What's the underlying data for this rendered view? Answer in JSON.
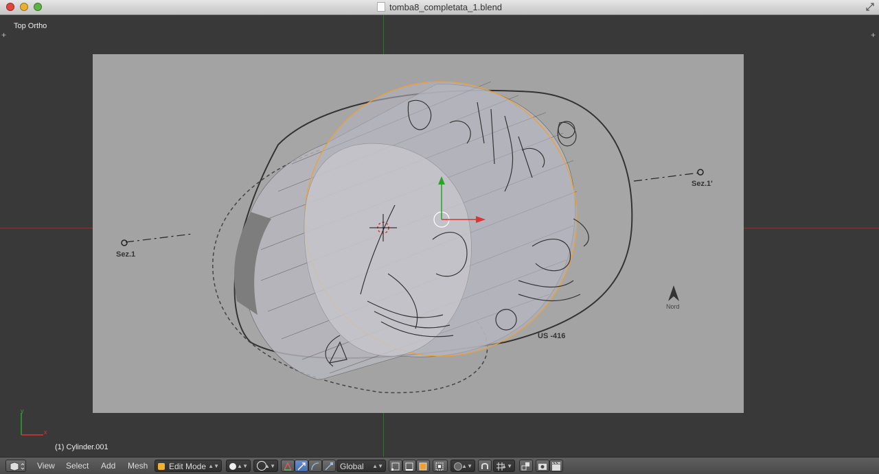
{
  "window": {
    "title": "tomba8_completata_1.blend"
  },
  "viewport": {
    "view_name": "Top Ortho",
    "active_object": "(1) Cylinder.001",
    "scene_labels": {
      "section_left": "Sez.1",
      "section_right": "Sez.1'",
      "us_label": "US -416",
      "north": "Nord"
    }
  },
  "toolbar": {
    "menus": [
      "View",
      "Select",
      "Add",
      "Mesh"
    ],
    "mode": "Edit Mode",
    "orientation": "Global"
  },
  "icons": {
    "editor_type": "cube-editor-icon",
    "shading": "solid-sphere-icon",
    "pivot": "pivot-icon",
    "manipulators": [
      "translate-icon",
      "rotate-icon",
      "scale-icon"
    ],
    "select_modes": [
      "vertex-select-icon",
      "edge-select-icon",
      "face-select-icon"
    ],
    "proportional": "proportional-edit-icon",
    "snap": "magnet-icon",
    "render": [
      "camera-render-icon",
      "clapboard-render-icon"
    ]
  },
  "colors": {
    "x_axis": "#7a3b3b",
    "y_axis": "#3d6a3d",
    "selection_outline": "#f0a030"
  }
}
